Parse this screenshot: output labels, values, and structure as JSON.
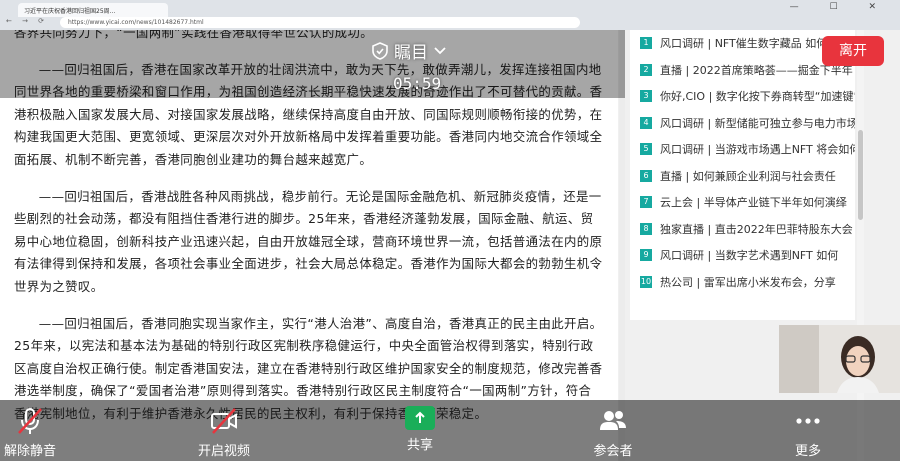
{
  "browser": {
    "tab_title": "习近平在庆祝香港回归祖国25周...",
    "url": "https://www.yicai.com/news/101482677.html"
  },
  "article": {
    "paragraphs": [
      "各界共同努力下，“一国两制”实践在香港取得举世公认的成功。",
      "——回归祖国后，香港在国家改革开放的壮阔洪流中，敢为天下先，敢做弄潮儿，发挥连接祖国内地同世界各地的重要桥梁和窗口作用，为祖国创造经济长期平稳快速发展的奇迹作出了不可替代的贡献。香港积极融入国家发展大局、对接国家发展战略，继续保持高度自由开放、同国际规则顺畅衔接的优势，在构建我国更大范围、更宽领域、更深层次对外开放新格局中发挥着重要功能。香港同内地交流合作领域全面拓展、机制不断完善，香港同胞创业建功的舞台越来越宽广。",
      "——回归祖国后，香港战胜各种风雨挑战，稳步前行。无论是国际金融危机、新冠肺炎疫情，还是一些剧烈的社会动荡，都没有阻挡住香港行进的脚步。25年来，香港经济蓬勃发展，国际金融、航运、贸易中心地位稳固，创新科技产业迅速兴起，自由开放雄冠全球，营商环境世界一流，包括普通法在内的原有法律得到保持和发展，各项社会事业全面进步，社会大局总体稳定。香港作为国际大都会的勃勃生机令世界为之赞叹。",
      "——回归祖国后，香港同胞实现当家作主，实行“港人治港”、高度自治，香港真正的民主由此开启。25年来，以宪法和基本法为基础的特别行政区宪制秩序稳健运行，中央全面管治权得到落实，特别行政区高度自治权正确行使。制定香港国安法，建立在香港特别行政区维护国家安全的制度规范，修改完善香港选举制度，确保了“爱国者治港”原则得到落实。香港特别行政区民主制度符合“一国两制”方针，符合香港宪制地位，有利于维护香港永久性居民的民主权利，有利于保持香港繁荣稳定。"
    ]
  },
  "sidebar": {
    "items": [
      {
        "rank": "1",
        "text": "风口调研 | NFT催生数字藏品 如何"
      },
      {
        "rank": "2",
        "text": "直播 | 2022首席策略荟——掘金下半年"
      },
      {
        "rank": "3",
        "text": "你好,CIO | 数字化按下券商转型“加速键”"
      },
      {
        "rank": "4",
        "text": "风口调研 | 新型储能可独立参与电力市场"
      },
      {
        "rank": "5",
        "text": "风口调研 | 当游戏市场遇上NFT 将会如何"
      },
      {
        "rank": "6",
        "text": "直播 | 如何兼顾企业利润与社会责任"
      },
      {
        "rank": "7",
        "text": "云上会 | 半导体产业链下半年如何演绎"
      },
      {
        "rank": "8",
        "text": "独家直播 | 直击2022年巴菲特股东大会"
      },
      {
        "rank": "9",
        "text": "风口调研 | 当数字艺术遇到NFT 如何"
      },
      {
        "rank": "10",
        "text": "热公司 | 雷军出席小米发布会，分享"
      }
    ]
  },
  "meeting": {
    "privacy_label": "瞩目",
    "timer": "05:59",
    "leave_label": "离开",
    "controls": {
      "unmute_label": "解除静音",
      "video_label": "开启视频",
      "share_label": "共享",
      "participants_label": "参会者",
      "more_label": "更多"
    }
  },
  "colors": {
    "leave_red": "#e8343d",
    "share_green": "#1aae59",
    "rank_teal": "#16a9a0"
  }
}
